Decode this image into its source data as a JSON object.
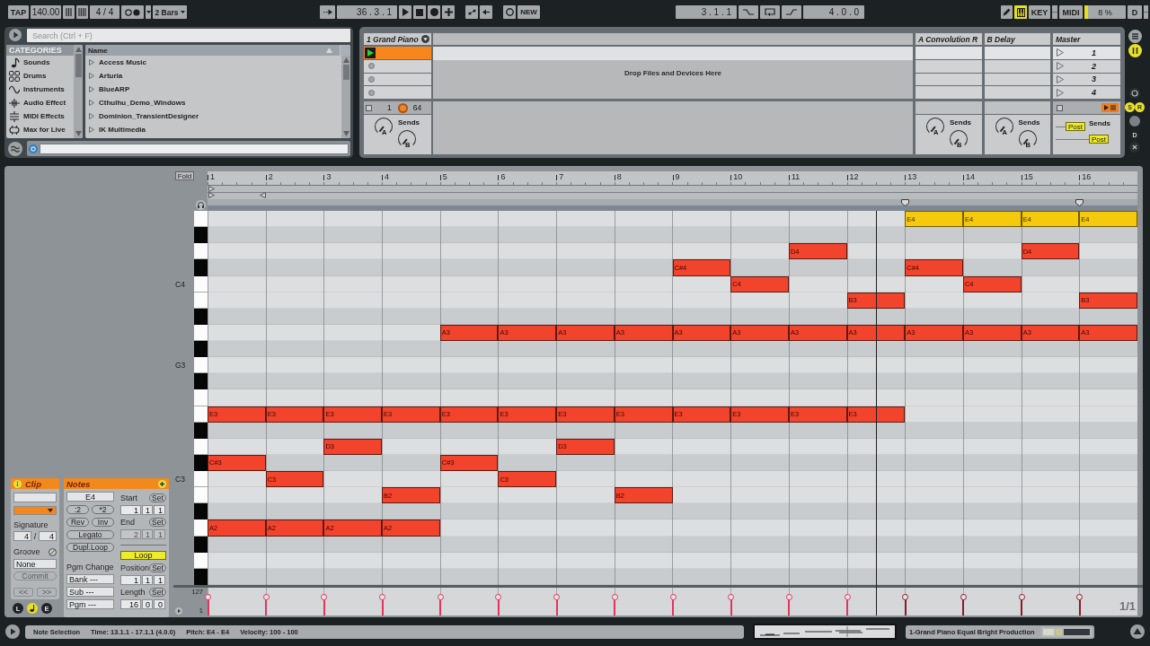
{
  "transport": {
    "tap": "TAP",
    "tempo": "140.00",
    "signature": "4 / 4",
    "quantization": "2 Bars",
    "position": "36 . 3 . 1",
    "new_label": "NEW",
    "loop_start": "3 . 1 . 1",
    "loop_length": "4 . 0 . 0",
    "draw_mode": {
      "on": true
    },
    "key_label": "KEY",
    "midi_label": "MIDI",
    "cpu": {
      "reading": "8 %",
      "level": 0.08
    },
    "disk_label": "D"
  },
  "browser": {
    "search": {
      "placeholder": "Search (Ctrl + F)"
    },
    "categories_title": "CATEGORIES",
    "categories": [
      {
        "kind": "sounds",
        "label": "Sounds"
      },
      {
        "kind": "drums",
        "label": "Drums"
      },
      {
        "kind": "instruments",
        "label": "Instruments"
      },
      {
        "kind": "audio_effects",
        "label": "Audio Effect"
      },
      {
        "kind": "midi_effects",
        "label": "MIDI Effects"
      },
      {
        "kind": "max_for_live",
        "label": "Max for Live"
      }
    ],
    "name_header": "Name",
    "items": [
      "Access Music",
      "Arturia",
      "BlueARP",
      "Cthulhu_Demo_Windows",
      "Dominion_TransientDesigner",
      "IK Multimedia"
    ]
  },
  "session": {
    "drop_hint": "Drop Files and Devices Here",
    "tracks": [
      {
        "kind": "midi",
        "title": "1 Grand Piano",
        "slots": [
          {
            "kind": "clip",
            "playing": true
          },
          {
            "kind": "stop"
          },
          {
            "kind": "stop"
          },
          {
            "kind": "stop"
          }
        ],
        "track_number": "1",
        "pan": "64",
        "sends_label": "Sends",
        "knobs": [
          "A",
          "B"
        ]
      },
      {
        "kind": "return",
        "title": "A Convolution R",
        "slots": [
          {
            "kind": "empty"
          },
          {
            "kind": "empty"
          },
          {
            "kind": "empty"
          },
          {
            "kind": "empty"
          }
        ],
        "sends_label": "Sends",
        "knobs": [
          "A",
          "B"
        ]
      },
      {
        "kind": "return",
        "title": "B Delay",
        "slots": [
          {
            "kind": "empty"
          },
          {
            "kind": "empty"
          },
          {
            "kind": "empty"
          },
          {
            "kind": "empty"
          }
        ],
        "sends_label": "Sends",
        "knobs": [
          "A",
          "B"
        ]
      }
    ],
    "master": {
      "title": "Master",
      "scenes": [
        {
          "label": "1",
          "selected": true
        },
        {
          "label": "2",
          "selected": false
        },
        {
          "label": "3",
          "selected": false
        },
        {
          "label": "4",
          "selected": false
        }
      ],
      "sends_label": "Sends",
      "post_buttons": [
        "Post",
        "Post"
      ]
    },
    "mixer_toggles": [
      {
        "label": "S",
        "on": true
      },
      {
        "label": "R",
        "on": true
      },
      {
        "label": "D",
        "on": false
      }
    ]
  },
  "clip_editor": {
    "fold": "Fold",
    "bars": [
      {
        "label": "1",
        "start_marker": true,
        "end_marker": false,
        "loop_marker": false
      },
      {
        "label": "2",
        "start_marker": false,
        "end_marker": true,
        "loop_marker": false
      },
      {
        "label": "3",
        "start_marker": false,
        "end_marker": false,
        "loop_marker": false
      },
      {
        "label": "4",
        "start_marker": false,
        "end_marker": false,
        "loop_marker": false
      },
      {
        "label": "5",
        "start_marker": false,
        "end_marker": false,
        "loop_marker": false
      },
      {
        "label": "6",
        "start_marker": false,
        "end_marker": false,
        "loop_marker": false
      },
      {
        "label": "7",
        "start_marker": false,
        "end_marker": false,
        "loop_marker": false
      },
      {
        "label": "8",
        "start_marker": false,
        "end_marker": false,
        "loop_marker": false
      },
      {
        "label": "9",
        "start_marker": false,
        "end_marker": false,
        "loop_marker": false
      },
      {
        "label": "10",
        "start_marker": false,
        "end_marker": false,
        "loop_marker": false
      },
      {
        "label": "11",
        "start_marker": false,
        "end_marker": false,
        "loop_marker": false
      },
      {
        "label": "12",
        "start_marker": false,
        "end_marker": false,
        "loop_marker": false
      },
      {
        "label": "13",
        "start_marker": false,
        "end_marker": false,
        "loop_marker": true
      },
      {
        "label": "14",
        "start_marker": false,
        "end_marker": false,
        "loop_marker": false
      },
      {
        "label": "15",
        "start_marker": false,
        "end_marker": false,
        "loop_marker": false
      },
      {
        "label": "16",
        "start_marker": false,
        "end_marker": false,
        "loop_marker": true
      }
    ],
    "rows": [
      {
        "kind": "natural",
        "steps": [
          {
            "kind": "rest"
          },
          {
            "kind": "rest"
          },
          {
            "kind": "rest"
          },
          {
            "kind": "rest"
          },
          {
            "kind": "rest"
          },
          {
            "kind": "rest"
          },
          {
            "kind": "rest"
          },
          {
            "kind": "rest"
          },
          {
            "kind": "rest"
          },
          {
            "kind": "rest"
          },
          {
            "kind": "rest"
          },
          {
            "kind": "rest"
          },
          {
            "kind": "note",
            "label": "E4",
            "selected": true
          },
          {
            "kind": "note",
            "label": "E4",
            "selected": true
          },
          {
            "kind": "note",
            "label": "E4",
            "selected": true
          },
          {
            "kind": "note",
            "label": "E4",
            "selected": true
          }
        ]
      },
      {
        "kind": "sharp"
      },
      {
        "kind": "natural",
        "steps": [
          {
            "kind": "rest"
          },
          {
            "kind": "rest"
          },
          {
            "kind": "rest"
          },
          {
            "kind": "rest"
          },
          {
            "kind": "rest"
          },
          {
            "kind": "rest"
          },
          {
            "kind": "rest"
          },
          {
            "kind": "rest"
          },
          {
            "kind": "rest"
          },
          {
            "kind": "rest"
          },
          {
            "kind": "note",
            "label": "D4",
            "selected": false
          },
          {
            "kind": "rest"
          },
          {
            "kind": "rest"
          },
          {
            "kind": "rest"
          },
          {
            "kind": "note",
            "label": "D4",
            "selected": false
          },
          {
            "kind": "rest"
          }
        ]
      },
      {
        "kind": "sharp",
        "steps": [
          {
            "kind": "rest"
          },
          {
            "kind": "rest"
          },
          {
            "kind": "rest"
          },
          {
            "kind": "rest"
          },
          {
            "kind": "rest"
          },
          {
            "kind": "rest"
          },
          {
            "kind": "rest"
          },
          {
            "kind": "rest"
          },
          {
            "kind": "note",
            "label": "C#4",
            "selected": false
          },
          {
            "kind": "rest"
          },
          {
            "kind": "rest"
          },
          {
            "kind": "rest"
          },
          {
            "kind": "note",
            "label": "C#4",
            "selected": false
          },
          {
            "kind": "rest"
          },
          {
            "kind": "rest"
          },
          {
            "kind": "rest"
          }
        ]
      },
      {
        "kind": "natural",
        "label": "C4",
        "steps": [
          {
            "kind": "rest"
          },
          {
            "kind": "rest"
          },
          {
            "kind": "rest"
          },
          {
            "kind": "rest"
          },
          {
            "kind": "rest"
          },
          {
            "kind": "rest"
          },
          {
            "kind": "rest"
          },
          {
            "kind": "rest"
          },
          {
            "kind": "rest"
          },
          {
            "kind": "note",
            "label": "C4",
            "selected": false
          },
          {
            "kind": "rest"
          },
          {
            "kind": "rest"
          },
          {
            "kind": "rest"
          },
          {
            "kind": "note",
            "label": "C4",
            "selected": false
          },
          {
            "kind": "rest"
          },
          {
            "kind": "rest"
          }
        ]
      },
      {
        "kind": "natural",
        "steps": [
          {
            "kind": "rest"
          },
          {
            "kind": "rest"
          },
          {
            "kind": "rest"
          },
          {
            "kind": "rest"
          },
          {
            "kind": "rest"
          },
          {
            "kind": "rest"
          },
          {
            "kind": "rest"
          },
          {
            "kind": "rest"
          },
          {
            "kind": "rest"
          },
          {
            "kind": "rest"
          },
          {
            "kind": "rest"
          },
          {
            "kind": "note",
            "label": "B3",
            "selected": false
          },
          {
            "kind": "rest"
          },
          {
            "kind": "rest"
          },
          {
            "kind": "rest"
          },
          {
            "kind": "note",
            "label": "B3",
            "selected": false
          }
        ]
      },
      {
        "kind": "sharp"
      },
      {
        "kind": "natural",
        "steps": [
          {
            "kind": "rest"
          },
          {
            "kind": "rest"
          },
          {
            "kind": "rest"
          },
          {
            "kind": "rest"
          },
          {
            "kind": "note",
            "label": "A3",
            "selected": false
          },
          {
            "kind": "note",
            "label": "A3",
            "selected": false
          },
          {
            "kind": "note",
            "label": "A3",
            "selected": false
          },
          {
            "kind": "note",
            "label": "A3",
            "selected": false
          },
          {
            "kind": "note",
            "label": "A3",
            "selected": false
          },
          {
            "kind": "note",
            "label": "A3",
            "selected": false
          },
          {
            "kind": "note",
            "label": "A3",
            "selected": false
          },
          {
            "kind": "note",
            "label": "A3",
            "selected": false
          },
          {
            "kind": "note",
            "label": "A3",
            "selected": false
          },
          {
            "kind": "note",
            "label": "A3",
            "selected": false
          },
          {
            "kind": "note",
            "label": "A3",
            "selected": false
          },
          {
            "kind": "note",
            "label": "A3",
            "selected": false
          }
        ]
      },
      {
        "kind": "sharp"
      },
      {
        "kind": "natural",
        "label": "G3"
      },
      {
        "kind": "sharp"
      },
      {
        "kind": "natural"
      },
      {
        "kind": "natural",
        "steps": [
          {
            "kind": "note",
            "label": "E3",
            "selected": false
          },
          {
            "kind": "note",
            "label": "E3",
            "selected": false
          },
          {
            "kind": "note",
            "label": "E3",
            "selected": false
          },
          {
            "kind": "note",
            "label": "E3",
            "selected": false
          },
          {
            "kind": "note",
            "label": "E3",
            "selected": false
          },
          {
            "kind": "note",
            "label": "E3",
            "selected": false
          },
          {
            "kind": "note",
            "label": "E3",
            "selected": false
          },
          {
            "kind": "note",
            "label": "E3",
            "selected": false
          },
          {
            "kind": "note",
            "label": "E3",
            "selected": false
          },
          {
            "kind": "note",
            "label": "E3",
            "selected": false
          },
          {
            "kind": "note",
            "label": "E3",
            "selected": false
          },
          {
            "kind": "note",
            "label": "E3",
            "selected": false
          },
          {
            "kind": "rest"
          },
          {
            "kind": "rest"
          },
          {
            "kind": "rest"
          },
          {
            "kind": "rest"
          }
        ]
      },
      {
        "kind": "sharp"
      },
      {
        "kind": "natural",
        "steps": [
          {
            "kind": "rest"
          },
          {
            "kind": "rest"
          },
          {
            "kind": "note",
            "label": "D3",
            "selected": false
          },
          {
            "kind": "rest"
          },
          {
            "kind": "rest"
          },
          {
            "kind": "rest"
          },
          {
            "kind": "note",
            "label": "D3",
            "selected": false
          },
          {
            "kind": "rest"
          },
          {
            "kind": "rest"
          },
          {
            "kind": "rest"
          },
          {
            "kind": "rest"
          },
          {
            "kind": "rest"
          },
          {
            "kind": "rest"
          },
          {
            "kind": "rest"
          },
          {
            "kind": "rest"
          },
          {
            "kind": "rest"
          }
        ]
      },
      {
        "kind": "sharp",
        "steps": [
          {
            "kind": "note",
            "label": "C#3",
            "selected": false
          },
          {
            "kind": "rest"
          },
          {
            "kind": "rest"
          },
          {
            "kind": "rest"
          },
          {
            "kind": "note",
            "label": "C#3",
            "selected": false
          },
          {
            "kind": "rest"
          },
          {
            "kind": "rest"
          },
          {
            "kind": "rest"
          },
          {
            "kind": "rest"
          },
          {
            "kind": "rest"
          },
          {
            "kind": "rest"
          },
          {
            "kind": "rest"
          },
          {
            "kind": "rest"
          },
          {
            "kind": "rest"
          },
          {
            "kind": "rest"
          },
          {
            "kind": "rest"
          }
        ]
      },
      {
        "kind": "natural",
        "label": "C3",
        "steps": [
          {
            "kind": "rest"
          },
          {
            "kind": "note",
            "label": "C3",
            "selected": false
          },
          {
            "kind": "rest"
          },
          {
            "kind": "rest"
          },
          {
            "kind": "rest"
          },
          {
            "kind": "note",
            "label": "C3",
            "selected": false
          },
          {
            "kind": "rest"
          },
          {
            "kind": "rest"
          },
          {
            "kind": "rest"
          },
          {
            "kind": "rest"
          },
          {
            "kind": "rest"
          },
          {
            "kind": "rest"
          },
          {
            "kind": "rest"
          },
          {
            "kind": "rest"
          },
          {
            "kind": "rest"
          },
          {
            "kind": "rest"
          }
        ]
      },
      {
        "kind": "natural",
        "steps": [
          {
            "kind": "rest"
          },
          {
            "kind": "rest"
          },
          {
            "kind": "rest"
          },
          {
            "kind": "note",
            "label": "B2",
            "selected": false
          },
          {
            "kind": "rest"
          },
          {
            "kind": "rest"
          },
          {
            "kind": "rest"
          },
          {
            "kind": "note",
            "label": "B2",
            "selected": false
          },
          {
            "kind": "rest"
          },
          {
            "kind": "rest"
          },
          {
            "kind": "rest"
          },
          {
            "kind": "rest"
          },
          {
            "kind": "rest"
          },
          {
            "kind": "rest"
          },
          {
            "kind": "rest"
          },
          {
            "kind": "rest"
          }
        ]
      },
      {
        "kind": "sharp"
      },
      {
        "kind": "natural",
        "steps": [
          {
            "kind": "note",
            "label": "A2",
            "selected": false
          },
          {
            "kind": "note",
            "label": "A2",
            "selected": false
          },
          {
            "kind": "note",
            "label": "A2",
            "selected": false
          },
          {
            "kind": "note",
            "label": "A2",
            "selected": false
          },
          {
            "kind": "rest"
          },
          {
            "kind": "rest"
          },
          {
            "kind": "rest"
          },
          {
            "kind": "rest"
          },
          {
            "kind": "rest"
          },
          {
            "kind": "rest"
          },
          {
            "kind": "rest"
          },
          {
            "kind": "rest"
          },
          {
            "kind": "rest"
          },
          {
            "kind": "rest"
          },
          {
            "kind": "rest"
          },
          {
            "kind": "rest"
          }
        ]
      },
      {
        "kind": "sharp"
      },
      {
        "kind": "natural"
      },
      {
        "kind": "sharp"
      }
    ],
    "playhead": {
      "level": 0.719
    },
    "velocity": {
      "max": "127",
      "min": "1",
      "stems": [
        {
          "level": 0.79,
          "selected": false
        },
        {
          "level": 0.79,
          "selected": false
        },
        {
          "level": 0.79,
          "selected": false
        },
        {
          "level": 0.79,
          "selected": false
        },
        {
          "level": 0.79,
          "selected": false
        },
        {
          "level": 0.79,
          "selected": false
        },
        {
          "level": 0.79,
          "selected": false
        },
        {
          "level": 0.79,
          "selected": false
        },
        {
          "level": 0.79,
          "selected": false
        },
        {
          "level": 0.79,
          "selected": false
        },
        {
          "level": 0.79,
          "selected": false
        },
        {
          "level": 0.79,
          "selected": false
        },
        {
          "level": 0.79,
          "selected": true
        },
        {
          "level": 0.79,
          "selected": true
        },
        {
          "level": 0.79,
          "selected": true
        },
        {
          "level": 0.79,
          "selected": true
        }
      ]
    },
    "page": "1/1"
  },
  "clip_view": {
    "clip": {
      "title": "Clip",
      "signature_label": "Signature",
      "signature": [
        "4",
        "4"
      ],
      "signature_separator": "/",
      "groove_label": "Groove",
      "groove": "None",
      "commit": {
        "label": "Commit",
        "disabled": true
      },
      "nudge": [
        {
          "label": "<<",
          "disabled": true
        },
        {
          "label": ">>",
          "disabled": true
        }
      ],
      "view_buttons": [
        {
          "kind": "letter",
          "label": "L",
          "selected": false
        },
        {
          "kind": "note",
          "selected": true
        },
        {
          "kind": "letter",
          "label": "E",
          "selected": false
        }
      ]
    },
    "notes": {
      "title": "Notes",
      "pitch": "E4",
      "transform_buttons": [
        ":2",
        "*2",
        "Rev",
        "Inv",
        "Legato",
        "Dupl.Loop"
      ],
      "program_label": "Pgm Change",
      "program_fields": [
        "Bank ---",
        "Sub ---",
        "Pgm ---"
      ],
      "markers": [
        {
          "label": "Start",
          "set": "Set",
          "values": [
            "1",
            "1",
            "1"
          ],
          "disabled": false
        },
        {
          "label": "End",
          "set": "Set",
          "values": [
            "2",
            "1",
            "1"
          ],
          "disabled": true
        }
      ],
      "loop": {
        "label": "Loop",
        "on": true
      },
      "loop_settings": [
        {
          "label": "Position",
          "set": "Set",
          "values": [
            "1",
            "1",
            "1"
          ],
          "disabled": false
        },
        {
          "label": "Length",
          "set": "Set",
          "values": [
            "16",
            "0",
            "0"
          ],
          "disabled": false
        }
      ]
    }
  },
  "status_bar": {
    "texts": [
      "Note Selection",
      "Time: 13.1.1 - 17.1.1 (4.0.0)",
      "Pitch: E4 - E4",
      "Velocity: 100 - 100"
    ],
    "device": "1-Grand Piano Equal Bright Production"
  }
}
